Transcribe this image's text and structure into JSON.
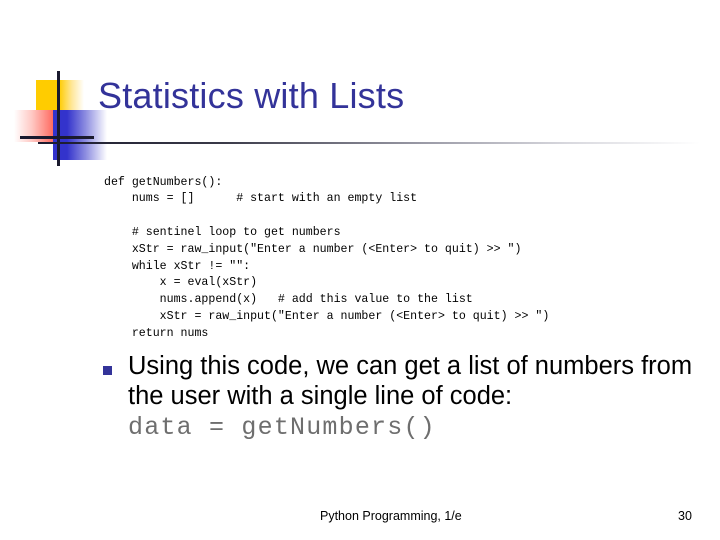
{
  "slide": {
    "title": "Statistics with Lists",
    "code": "def getNumbers():\n    nums = []      # start with an empty list\n\n    # sentinel loop to get numbers\n    xStr = raw_input(\"Enter a number (<Enter> to quit) >> \")\n    while xStr != \"\":\n        x = eval(xStr)\n        nums.append(x)   # add this value to the list\n        xStr = raw_input(\"Enter a number (<Enter> to quit) >> \")\n    return nums",
    "bullet": {
      "marker": "square-bullet",
      "text": "Using this code, we can get a list of numbers from the user with a single line of code:",
      "code_line": "data = getNumbers()"
    },
    "footer": {
      "title": "Python Programming, 1/e",
      "page_number": "30"
    },
    "decoration": {
      "name": "corner-accent-graphic",
      "yellow": "#FFCC00",
      "red": "#FF3B30",
      "blue": "#3333CC",
      "line": "#1A1A2E"
    },
    "colors": {
      "title": "#333399",
      "body": "#000000",
      "code_accent": "#6E6E6E",
      "background": "#FFFFFF"
    }
  }
}
